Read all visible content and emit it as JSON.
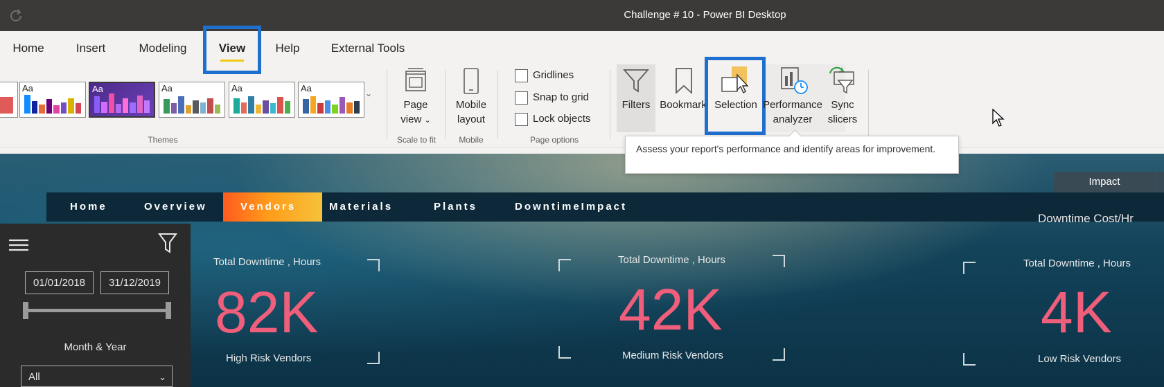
{
  "window": {
    "title": "Challenge # 10 - Power BI Desktop"
  },
  "menu": {
    "tabs": [
      {
        "label": "Home"
      },
      {
        "label": "Insert"
      },
      {
        "label": "Modeling"
      },
      {
        "label": "View"
      },
      {
        "label": "Help"
      },
      {
        "label": "External Tools"
      }
    ],
    "active": "View"
  },
  "ribbon": {
    "themes": {
      "swatch_label": "Aa",
      "group_label": "Themes"
    },
    "scale_to_fit": {
      "button_line1": "Page",
      "button_line2": "view",
      "group_label": "Scale to fit"
    },
    "mobile": {
      "button_line1": "Mobile",
      "button_line2": "layout",
      "group_label": "Mobile"
    },
    "page_options": {
      "gridlines": "Gridlines",
      "snap_to_grid": "Snap to grid",
      "lock_objects": "Lock objects",
      "group_label": "Page options"
    },
    "show_panes": {
      "filters": "Filters",
      "bookmarks": "Bookmark",
      "selection": "Selection",
      "performance_line1": "Performance",
      "performance_line2": "analyzer",
      "sync_line1": "Sync",
      "sync_line2": "slicers"
    }
  },
  "tooltip": {
    "text": "Assess your report's performance and identify areas for improvement."
  },
  "report": {
    "nav": [
      {
        "label": "Home"
      },
      {
        "label": "Overview"
      },
      {
        "label": "Vendors"
      },
      {
        "label": "Materials"
      },
      {
        "label": "Plants"
      },
      {
        "label": "DowntimeImpact"
      }
    ],
    "active_nav": "Vendors",
    "impact_tab": "Impact",
    "downtime_cost_label": "Downtime Cost/Hr",
    "filter_panel": {
      "date_start": "01/01/2018",
      "date_end": "31/12/2019",
      "month_year_label": "Month & Year",
      "month_year_value": "All"
    },
    "kpis": [
      {
        "label": "Total Downtime , Hours",
        "value": "82K",
        "sub": "High Risk Vendors"
      },
      {
        "label": "Total Downtime , Hours",
        "value": "42K",
        "sub": "Medium Risk Vendors"
      },
      {
        "label": "Total Downtime , Hours",
        "value": "4K",
        "sub": "Low Risk Vendors"
      }
    ]
  },
  "colors": {
    "accent_highlight": "#1f6fd0",
    "kpi_value": "#ef5e7a",
    "active_tab_underline": "#f2c811"
  }
}
